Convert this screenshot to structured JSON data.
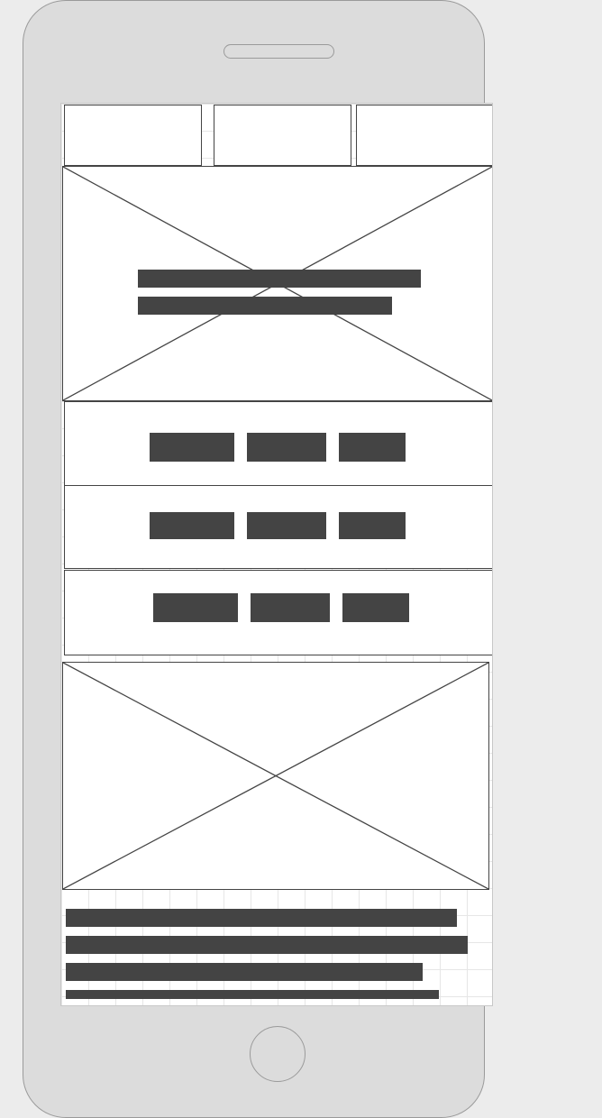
{
  "wireframe": {
    "colors": {
      "device_frame": "#dcdcdc",
      "device_outline": "#9a9a9a",
      "screen_background": "#ffffff",
      "grid_line": "#e6e6e6",
      "placeholder_stroke": "#444444",
      "text_block": "#444444",
      "page_background": "#ececec"
    },
    "icons": {
      "image_placeholder": "image-placeholder-icon",
      "speaker": "speaker-icon",
      "home_button": "home-button-icon"
    },
    "top_tabs_count": 3,
    "hero_text_lines": 2,
    "menu_rows": [
      {
        "buttons": 3
      },
      {
        "buttons": 3
      },
      {
        "buttons": 3
      }
    ],
    "body_text_lines": 4
  }
}
